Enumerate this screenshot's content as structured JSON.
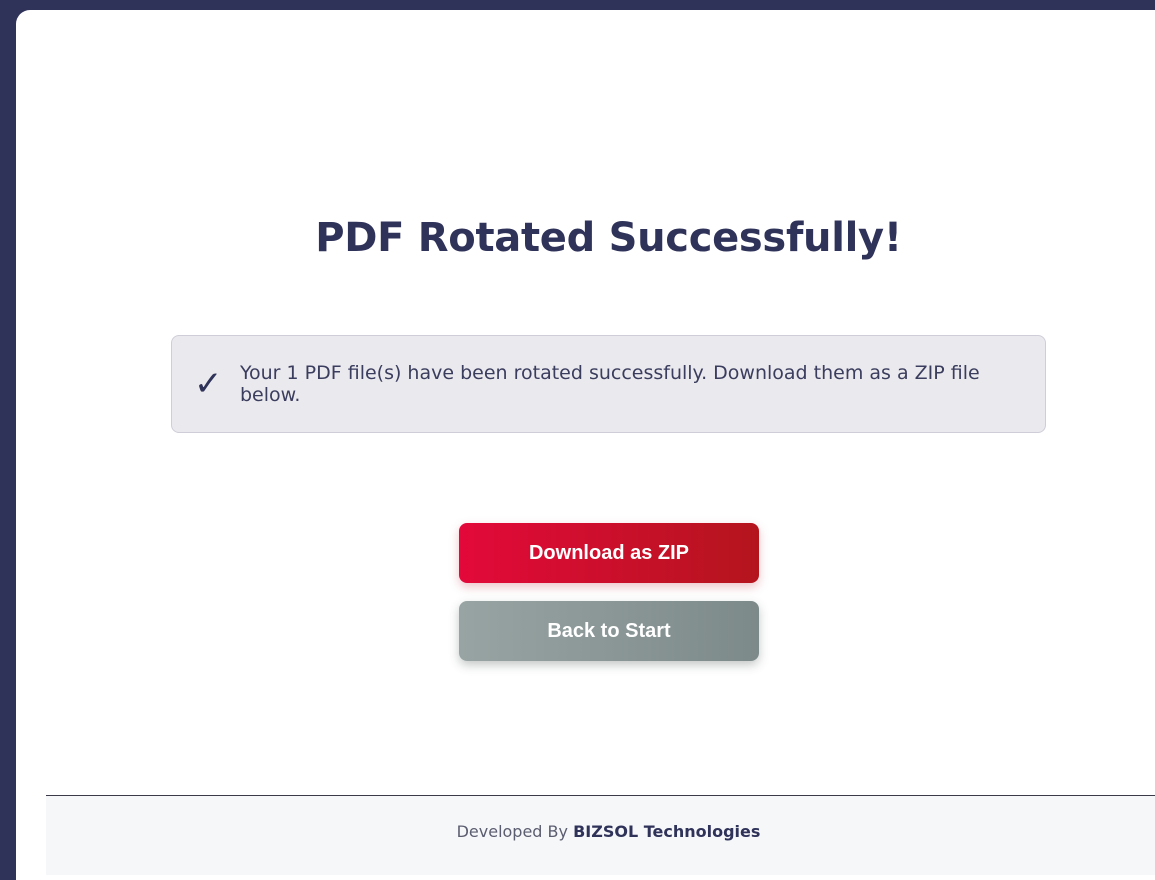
{
  "page": {
    "title": "PDF Rotated Successfully!"
  },
  "notice": {
    "icon": "check-icon",
    "icon_glyph": "✓",
    "message": "Your 1 PDF file(s) have been rotated successfully. Download them as a ZIP file below."
  },
  "actions": {
    "download_label": "Download as ZIP",
    "back_label": "Back to Start"
  },
  "footer": {
    "prefix": "Developed By ",
    "brand": "BIZSOL Technologies"
  },
  "colors": {
    "frame": "#2f3259",
    "primary_start": "#e3093a",
    "primary_end": "#b4151d",
    "secondary_start": "#98a4a3",
    "secondary_end": "#7d8a8a",
    "notice_bg": "#eae9ee"
  }
}
